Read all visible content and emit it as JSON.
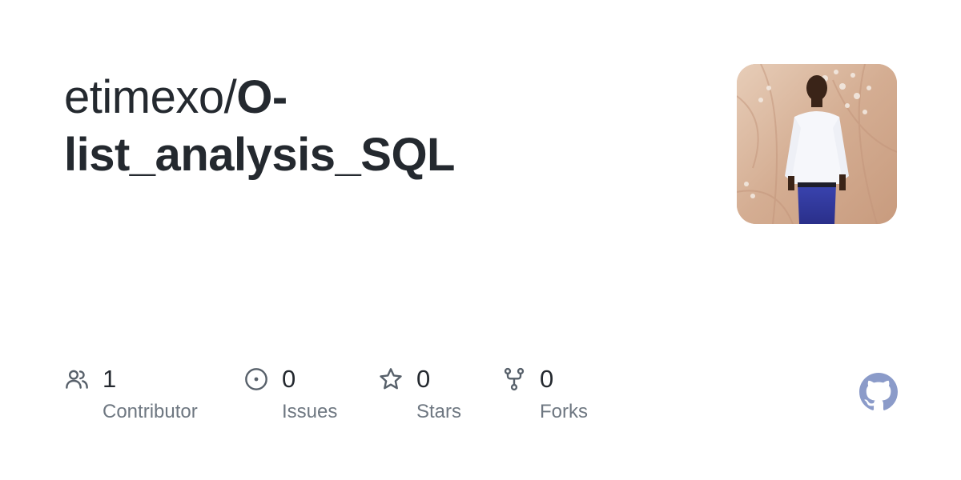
{
  "repo": {
    "owner": "etimexo",
    "separator": "/",
    "name": "O-list_analysis_SQL"
  },
  "avatar": {
    "icon": "avatar-photo"
  },
  "stats": [
    {
      "icon": "people-icon",
      "count": "1",
      "label": "Contributor"
    },
    {
      "icon": "issue-opened-icon",
      "count": "0",
      "label": "Issues"
    },
    {
      "icon": "star-icon",
      "count": "0",
      "label": "Stars"
    },
    {
      "icon": "repo-forked-icon",
      "count": "0",
      "label": "Forks"
    }
  ],
  "brand": {
    "icon": "github-mark-icon",
    "color": "#8b9bc9"
  },
  "colors": {
    "text": "#24292f",
    "muted": "#6e7781",
    "icon": "#57606a"
  }
}
